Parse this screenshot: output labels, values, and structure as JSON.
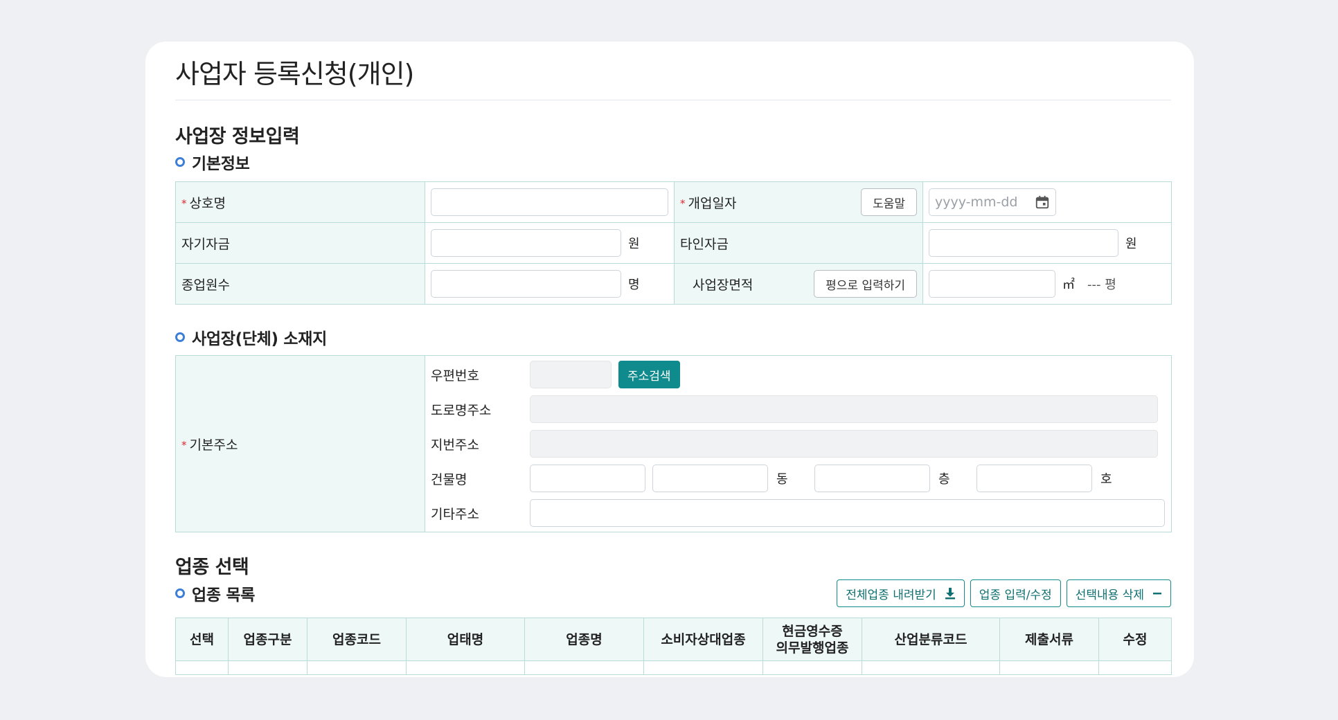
{
  "page_title": "사업자 등록신청(개인)",
  "section_business": "사업장 정보입력",
  "basic_info": {
    "title": "기본정보",
    "trade_name_label": "상호명",
    "opening_date_label": "개업일자",
    "help_button": "도움말",
    "date_placeholder": "yyyy-mm-dd",
    "own_capital_label": "자기자금",
    "won_unit": "원",
    "other_capital_label": "타인자금",
    "employees_label": "종업원수",
    "people_unit": "명",
    "area_label": "사업장면적",
    "pyeong_input_button": "평으로 입력하기",
    "sqm_unit": "㎡",
    "pyeong_value": "--- 평"
  },
  "location": {
    "title": "사업장(단체) 소재지",
    "basic_address_label": "기본주소",
    "postal_code_label": "우편번호",
    "address_search_button": "주소검색",
    "road_address_label": "도로명주소",
    "lot_address_label": "지번주소",
    "building_label": "건물명",
    "dong_unit": "동",
    "floor_unit": "층",
    "ho_unit": "호",
    "other_address_label": "기타주소"
  },
  "section_industry": "업종 선택",
  "industry_list": {
    "title": "업종 목록",
    "download_button": "전체업종 내려받기",
    "edit_button": "업종 입력/수정",
    "delete_button": "선택내용 삭제",
    "columns": [
      "선택",
      "업종구분",
      "업종코드",
      "업태명",
      "업종명",
      "소비자상대업종",
      "현금영수증\n의무발행업종",
      "산업분류코드",
      "제출서류",
      "수정"
    ]
  },
  "colors": {
    "accent_teal": "#0f8b8d",
    "label_bg": "#eef8f7",
    "border": "#b9dcd8",
    "bullet_blue": "#3b7fd8",
    "required_red": "#e0262f"
  }
}
